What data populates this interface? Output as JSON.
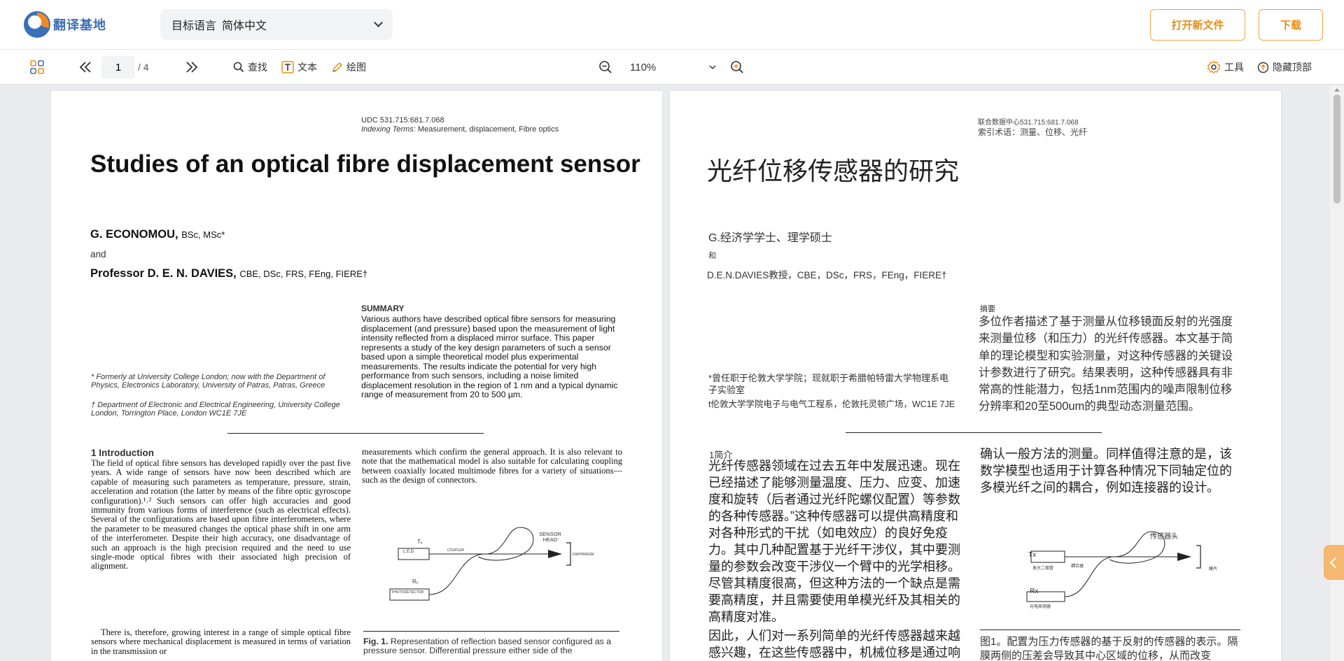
{
  "header": {
    "logo_text": "翻译基地",
    "language_selector": {
      "label": "目标语言",
      "value": "简体中文"
    },
    "open_file_label": "打开新文件",
    "download_label": "下载"
  },
  "toolbar": {
    "current_page": "1",
    "total_pages": "/ 4",
    "find_label": "查找",
    "text_label": "文本",
    "draw_label": "绘图",
    "zoom_value": "110%",
    "tools_label": "工具",
    "hide_top_label": "隐藏顶部"
  },
  "original": {
    "udc": "UDC 531.715:681.7.068",
    "indexing_label": "Indexing Terms:",
    "indexing_value": "Measurement, displacement, Fibre optics",
    "title": "Studies of an optical fibre displacement sensor",
    "author1_name": "G. ECONOMOU,",
    "author1_deg": "BSc, MSc*",
    "and": "and",
    "author2_name": "Professor D. E. N. DAVIES,",
    "author2_deg": "CBE, DSc, FRS, FEng, FIERE†",
    "summary_heading": "SUMMARY",
    "summary_text": "Various authors have described optical fibre sensors for measuring displacement (and pressure) based upon the measurement of light intensity reflected from a displaced mirror surface. This paper represents a study of the key design parameters of such a sensor based upon a simple theoretical model plus experimental measurements. The results indicate the potential for very high performance from such sensors, including a noise limited displacement resolution in the region of 1 nm and a typical dynamic range of measurement from 20 to 500 µm.",
    "footnote1": "* Formerly at University College London; now with the Department of Physics, Electronics Laboratory, University of Patras, Patras, Greece",
    "footnote2": "† Department of Electronic and Electrical Engineering, University College London, Torrington Place, London WC1E 7JE",
    "intro_heading": "1 Introduction",
    "intro_text_1": "The field of optical fibre sensors has developed rapidly over the past five years. A wide range of sensors have now been described which are capable of measuring such parameters as temperature, pressure, strain, acceleration and rotation (the latter by means of the fibre optic gyroscope configuration).¹˒² Such sensors can offer high accuracies and good immunity from various forms of interference (such as electrical effects). Several of the configurations are based upon fibre interferometers, where the parameter to be measured changes the optical phase shift in one arm of the interferometer. Despite their high accuracy, one disadvantage of such an approach is the high precision required and the need to use single-mode optical fibres with their associated high precision of alignment.",
    "intro_text_2": "There is, therefore, growing interest in a range of simple optical fibre sensors where mechanical displacement is measured in terms of variation in the transmission or",
    "col2_text": "measurements which confirm the general approach. It is also relevant to note that the mathematical model is also suitable for calculating coupling between coaxially located multimode fibres for a variety of situations—such as the design of connectors.",
    "fig_label_sensor_head": "SENSOR HEAD",
    "fig_label_tx": "Tₓ",
    "fig_label_led": "L.E.D.",
    "fig_label_coupler": "COUPLER",
    "fig_label_rx": "Rₓ",
    "fig_label_photodetector": "PHOTODETECTOR",
    "fig_label_diaphragm": "DIAPHRAGM",
    "fig_caption_label": "Fig. 1.",
    "fig_caption_text": "Representation of reflection based sensor configured as a pressure sensor. Differential pressure either side of the"
  },
  "translation": {
    "udc": "联合数据中心531.715:681.7.068",
    "indexing": "索引术语：测量、位移、光纤",
    "title": "光纤位移传感器的研究",
    "author1": "G.经济学学士、理学硕士",
    "and": "和",
    "author2": "D.E.N.DAVIES教授，CBE，DSc，FRS，FEng，FIERE†",
    "summary_heading": "摘要",
    "summary_text": "多位作者描述了基于测量从位移镜面反射的光强度来测量位移（和压力）的光纤传感器。本文基于简单的理论模型和实验测量，对这种传感器的关键设计参数进行了研究。结果表明，这种传感器具有非常高的性能潜力，包括1nm范围内的噪声限制位移分辨率和20至500um的典型动态测量范围。",
    "footnote1": "*曾任职于伦敦大学学院；现就职于希腊帕特雷大学物理系电子实验室",
    "footnote2": "t伦敦大学学院电子与电气工程系，伦敦托灵顿广场，WC1E 7JE",
    "intro_heading": "1简介",
    "intro_text": "光纤传感器领域在过去五年中发展迅速。现在已经描述了能够测量温度、压力、应变、加速度和旋转（后者通过光纤陀螺仪配置）等参数的各种传感器。”这种传感器可以提供高精度和对各种形式的干扰（如电效应）的良好免疫力。其中几种配置基于光纤干涉仪，其中要测量的参数会改变干涉仪一个臂中的光学相移。尽管其精度很高，但这种方法的一个缺点是需要高精度，并且需要使用单模光纤及其相关的高精度对准。",
    "intro_text_2": "因此，人们对一系列简单的光纤传感器越来越感兴趣，在这些传感器中，机械位移是通过响应于机械位移而通过传感器头的光的透射率",
    "col2_text": "确认一般方法的测量。同样值得注意的是，该数学模型也适用于计算各种情况下同轴定位的多模光纤之间的耦合，例如连接器的设计。",
    "fig_label_sensor_head": "传感器头",
    "fig_label_tx": "Tx",
    "fig_label_led": "发光二极管",
    "fig_label_coupler": "耦合器",
    "fig_label_rx": "Rx",
    "fig_label_photodetector": "光电探测器",
    "fig_label_diaphragm": "膜片",
    "fig_caption": "图1。配置为压力传感器的基于反射的传感器的表示。隔膜两侧的压差会导致其中心区域的位移，从而改变"
  },
  "colors": {
    "accent": "#e88d12",
    "brand": "#3b6fb6"
  }
}
